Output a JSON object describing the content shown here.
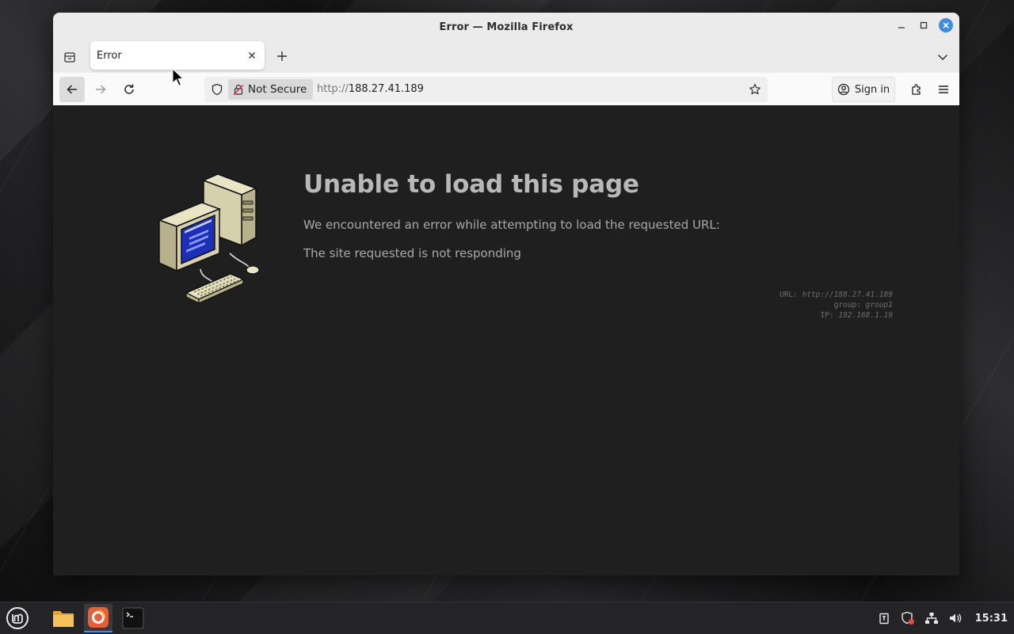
{
  "window": {
    "title": "Error — Mozilla Firefox"
  },
  "tab": {
    "title": "Error"
  },
  "navbar": {
    "security_label": "Not Secure",
    "url_scheme": "http://",
    "url_host": "188.27.41.189",
    "signin_label": "Sign in"
  },
  "error": {
    "title": "Unable to load this page",
    "message": "We encountered an error while attempting to load the requested URL:",
    "reason": "The site requested is not responding",
    "details": {
      "url_label": "URL:",
      "url_value": "http://188.27.41.189",
      "group_label": "group:",
      "group_value": "group1",
      "ip_label": "IP:",
      "ip_value": "192.168.1.19"
    }
  },
  "taskbar": {
    "clock": "15:31"
  },
  "colors": {
    "accent": "#3d8ee2",
    "page_bg": "#1f1f20",
    "chrome_bg": "#ebebeb"
  }
}
